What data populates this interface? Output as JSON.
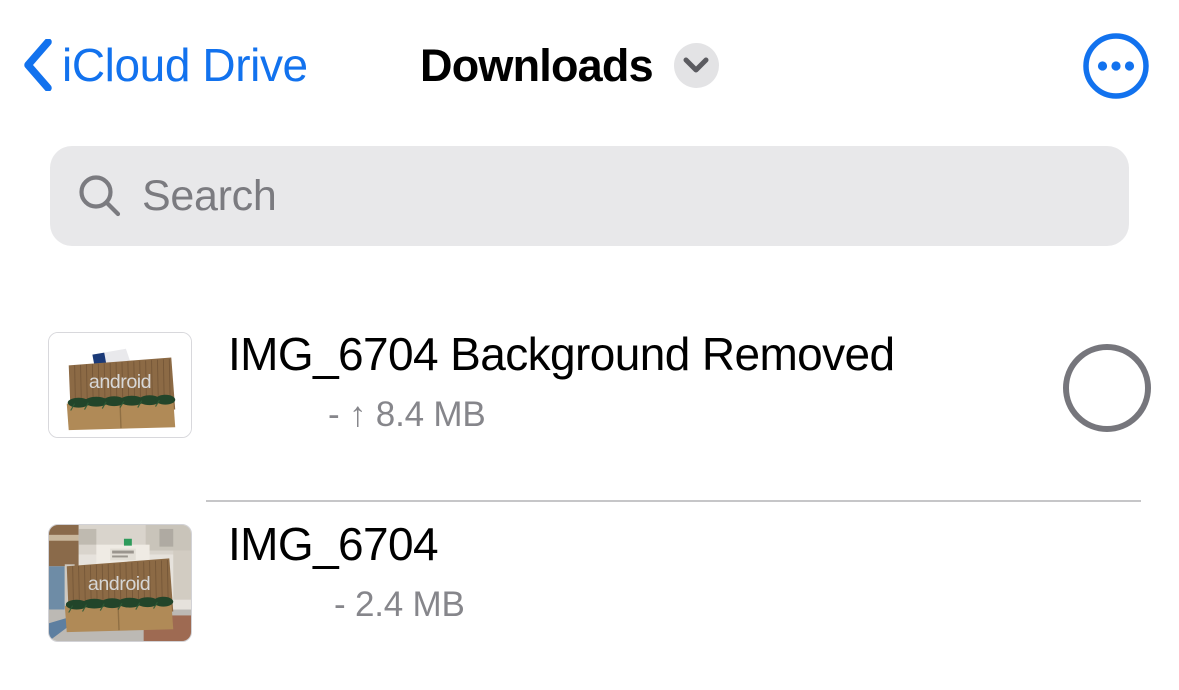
{
  "navbar": {
    "back_label": "iCloud Drive",
    "back_icon": "chevron-left-icon",
    "title": "Downloads",
    "title_chevron_icon": "chevron-down-icon",
    "more_icon": "ellipsis-circle-icon",
    "accent_color": "#1272EE",
    "title_color": "#000000",
    "chevron_button_bg": "#E3E3E5"
  },
  "search": {
    "placeholder": "Search",
    "icon": "search-icon",
    "background": "#E8E8EA",
    "text_color": "#7B7B80"
  },
  "files": [
    {
      "name": "IMG_6704 Background Removed",
      "detail": "- ↑ 8.4 MB",
      "thumbnail": "android-sign-background-removed-thumbnail",
      "has_status_circle": true,
      "status_circle_color": "#76767C"
    },
    {
      "name": "IMG_6704",
      "detail": "- 2.4 MB",
      "thumbnail": "android-sign-photo-thumbnail",
      "has_status_circle": false
    }
  ]
}
